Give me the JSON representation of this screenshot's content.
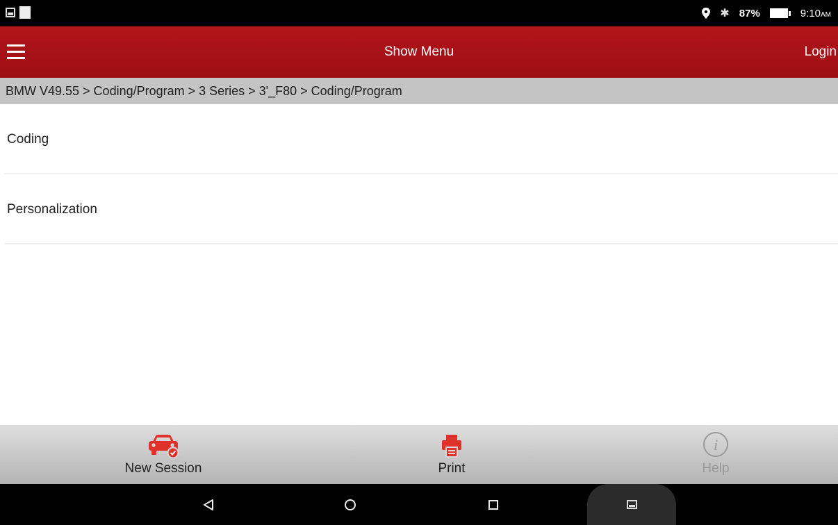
{
  "status_bar": {
    "battery": "87%",
    "time": "9:10",
    "ampm": "AM",
    "icons": [
      "image-notification-icon",
      "square-notification-icon",
      "location-icon",
      "bluetooth-icon",
      "battery-icon"
    ]
  },
  "header": {
    "title": "Show Menu",
    "login": "Login",
    "color": "#a81116"
  },
  "breadcrumb": "BMW V49.55 > Coding/Program > 3 Series > 3'_F80 > Coding/Program",
  "menu": {
    "items": [
      {
        "label": "Coding"
      },
      {
        "label": "Personalization"
      }
    ]
  },
  "toolbar": {
    "new_session": "New Session",
    "print": "Print",
    "help": "Help",
    "accent": "#e0312b"
  },
  "nav": {
    "icons": [
      "back-icon",
      "home-icon",
      "recent-apps-icon",
      "screenshot-icon"
    ]
  }
}
